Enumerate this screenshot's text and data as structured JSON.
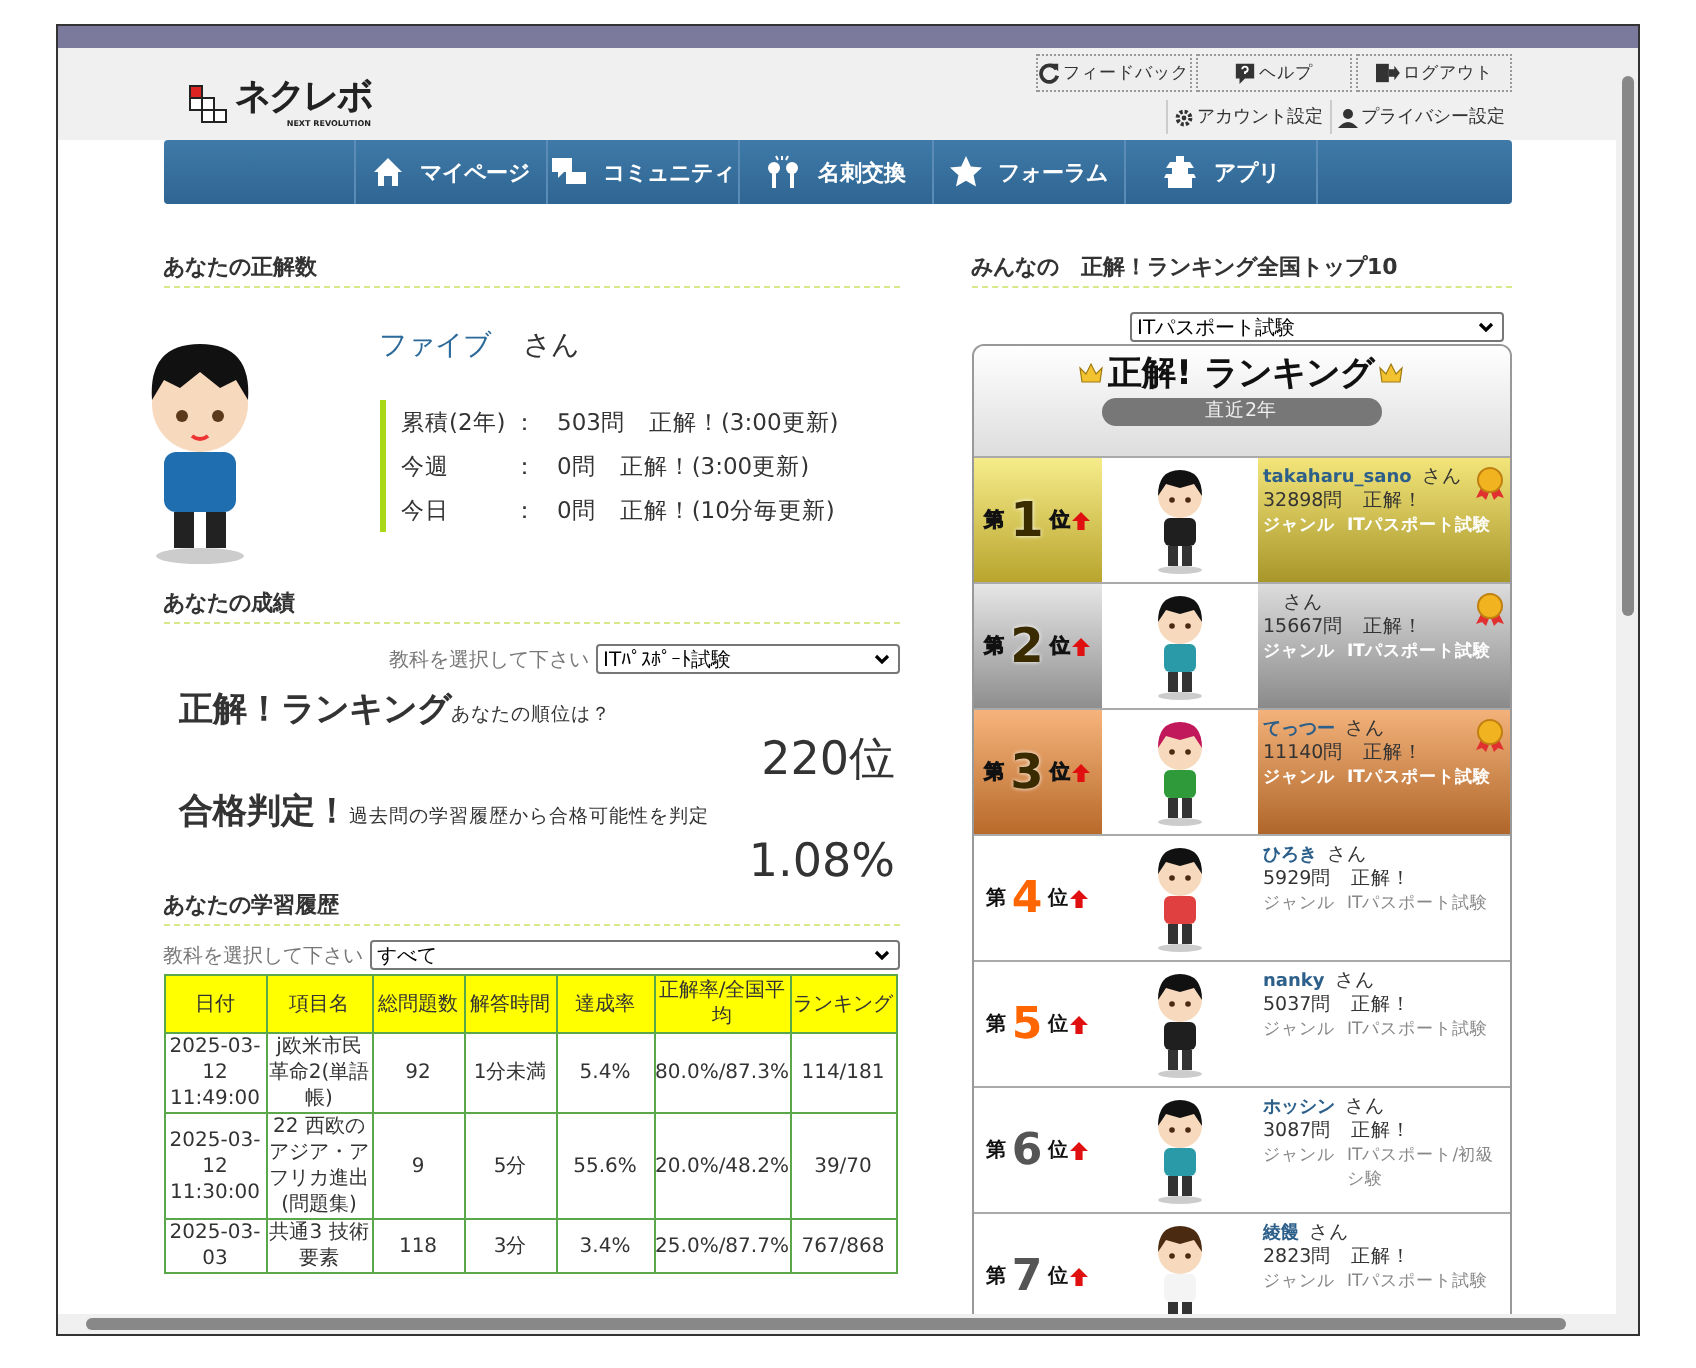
{
  "header": {
    "logo": {
      "name": "ネクレボ",
      "tagline": "NEXT REVOLUTION"
    },
    "buttons": [
      "フィードバック",
      "ヘルプ",
      "ログアウト"
    ],
    "links": [
      "アカウント設定",
      "プライバシー設定"
    ]
  },
  "nav": [
    "マイページ",
    "コミュニティ",
    "名刺交換",
    "フォーラム",
    "アプリ"
  ],
  "correct_count": {
    "title": "あなたの正解数",
    "user": "ファイブ",
    "honorific": "さん",
    "stats": [
      {
        "label": "累積(2年)",
        "colon": "：",
        "value": "503問　正解！(3:00更新)"
      },
      {
        "label": "今週",
        "colon": "：",
        "value": "0問　正解！(3:00更新)"
      },
      {
        "label": "今日",
        "colon": "：",
        "value": "0問　正解！(10分毎更新)"
      }
    ]
  },
  "results": {
    "title": "あなたの成績",
    "select_label": "教科を選択して下さい",
    "select_value": "ITﾊﾟｽﾎﾟｰﾄ試験",
    "blocks": [
      {
        "heading": "正解！ランキング",
        "sub": "あなたの順位は？",
        "value": "220位"
      },
      {
        "heading": "合格判定！",
        "sub": "過去問の学習履歴から合格可能性を判定",
        "value": "1.08%"
      }
    ]
  },
  "history": {
    "title": "あなたの学習履歴",
    "select_label": "教科を選択して下さい",
    "select_value": "すべて",
    "columns": [
      "日付",
      "項目名",
      "総問題数",
      "解答時間",
      "達成率",
      "正解率/全国平均",
      "ランキング"
    ],
    "rows": [
      [
        "2025-03-12 11:49:00",
        "j欧米市民革命2(単語帳)",
        "92",
        "1分未満",
        "5.4%",
        "80.0%/87.3%",
        "114/181"
      ],
      [
        "2025-03-12 11:30:00",
        "22 西欧のアジア・アフリカ進出(問題集)",
        "9",
        "5分",
        "55.6%",
        "20.0%/48.2%",
        "39/70"
      ],
      [
        "2025-03-03",
        "共通3 技術要素",
        "118",
        "3分",
        "3.4%",
        "25.0%/87.7%",
        "767/868"
      ]
    ]
  },
  "top10": {
    "title": "みんなの　正解！ランキング全国トップ10",
    "select_value": "ITパスポート試験",
    "heading": "正解! ランキング",
    "period": "直近2年",
    "entries": [
      {
        "kind": "gold",
        "prefix": "第",
        "rank": "1",
        "suffix": "位",
        "name": "takaharu_sano",
        "honorific": "さん",
        "count": "32898問",
        "correct": "正解！",
        "genre_label": "ジャンル",
        "genre": "ITパスポート試験"
      },
      {
        "kind": "silver",
        "prefix": "第",
        "rank": "2",
        "suffix": "位",
        "honorific": "さん",
        "count": "15667問",
        "correct": "正解！",
        "genre_label": "ジャンル",
        "genre": "ITパスポート試験"
      },
      {
        "kind": "bronze",
        "prefix": "第",
        "rank": "3",
        "suffix": "位",
        "name": "てっつー",
        "honorific": "さん",
        "count": "11140問",
        "correct": "正解！",
        "genre_label": "ジャンル",
        "genre": "ITパスポート試験"
      },
      {
        "kind": "plain",
        "color": "#ff6600",
        "prefix": "第",
        "rank": "4",
        "suffix": "位",
        "name": "ひろき",
        "honorific": "さん",
        "count": "5929問",
        "correct": "正解！",
        "genre_label": "ジャンル",
        "genre": "ITパスポート試験"
      },
      {
        "kind": "plain",
        "color": "#ff6600",
        "prefix": "第",
        "rank": "5",
        "suffix": "位",
        "name": "nanky",
        "honorific": "さん",
        "count": "5037問",
        "correct": "正解！",
        "genre_label": "ジャンル",
        "genre": "ITパスポート試験"
      },
      {
        "kind": "plain",
        "color": "#555555",
        "prefix": "第",
        "rank": "6",
        "suffix": "位",
        "name": "ホッシン",
        "honorific": "さん",
        "count": "3087問",
        "correct": "正解！",
        "genre_label": "ジャンル",
        "genre": "ITパスポート/初級シ験"
      },
      {
        "kind": "plain",
        "color": "#555555",
        "prefix": "第",
        "rank": "7",
        "suffix": "位",
        "name": "綾饅",
        "honorific": "さん",
        "count": "2823問",
        "correct": "正解！",
        "genre_label": "ジャンル",
        "genre": "ITパスポート試験"
      }
    ]
  }
}
